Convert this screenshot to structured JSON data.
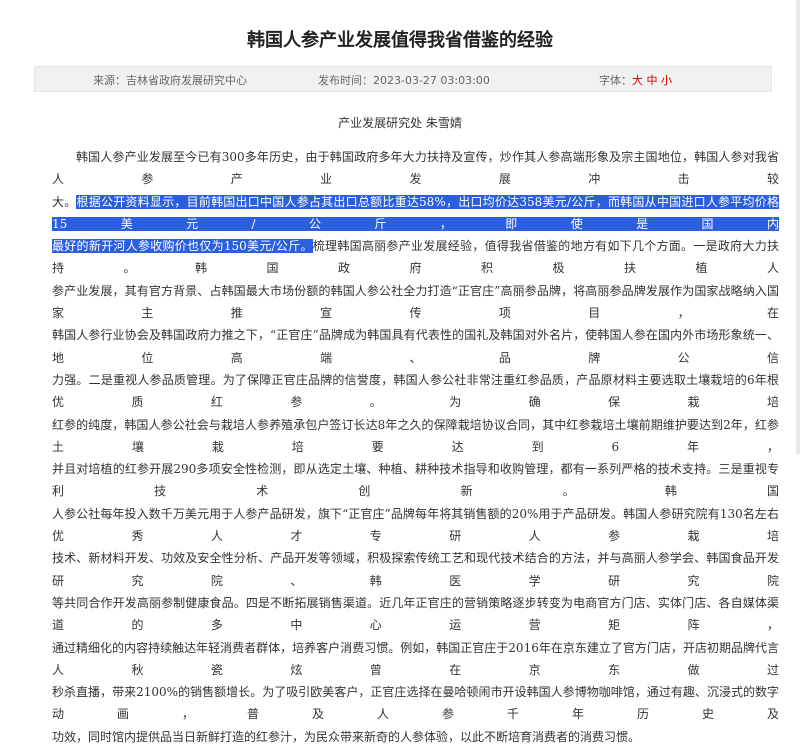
{
  "article": {
    "title": "韩国人参产业发展值得我省借鉴的经验",
    "meta": {
      "source_label": "来源：吉林省政府发展研究中心",
      "time_label": "发布时间：2023-03-27 03:03:00",
      "font_label": "字体：",
      "font_sizes": [
        "大",
        "中",
        "小"
      ]
    },
    "author": "产业发展研究处  朱雪婧",
    "lines": {
      "l1": "韩国人参产业发展至今已有300多年历史，由于韩国政府多年大力扶持及宣传，炒作其人参高端形象及宗主国地位，韩国人参对我省人参产业发展冲击较",
      "l2_plain": "大。",
      "l2_hl": "根据公开资料显示，目前韩国出口中国人参占其出口总额比重达58%，出口均价达358美元/公斤，而韩国从中国进口人参平均价格15美元/公斤，即使是国内",
      "l3_hl": "最好的新开河人参收购价也仅为150美元/公斤。",
      "l3_plain": "梳理韩国高丽参产业发展经验，值得我省借鉴的地方有如下几个方面。一是政府大力扶持。韩国政府积极扶植人",
      "l4": "参产业发展，其有官方背景、占韩国最大市场份额的韩国人参公社全力打造“正官庄”高丽参品牌，将高丽参品牌发展作为国家战略纳入国家主推宣传项目，在",
      "l5": "韩国人参行业协会及韩国政府力推之下，“正官庄”品牌成为韩国具有代表性的国礼及韩国对外名片，使韩国人参在国内外市场形象统一、地位高端、品牌公信",
      "l6": "力强。二是重视人参品质管理。为了保障正官庄品牌的信誉度，韩国人参公社非常注重红参品质，产品原材料主要选取土壤栽培的6年根优质红参。为确保栽培",
      "l7": "红参的纯度，韩国人参公社会与栽培人参养殖承包户签订长达8年之久的保障栽培协议合同，其中红参栽培土壤前期维护要达到2年，红参土壤栽培要达到6年，",
      "l8": "并且对培植的红参开展290多项安全性检测，即从选定土壤、种植、耕种技术指导和收购管理，都有一系列严格的技术支持。三是重视专利技术创新。韩国",
      "l9": "人参公社每年投入数千万美元用于人参产品研发，旗下“正官庄”品牌每年将其销售额的20%用于产品研发。韩国人参研究院有130名左右优秀人才专研人参栽培",
      "l10": "技术、新材料开发、功效及安全性分析、产品开发等领域，积极探索传统工艺和现代技术结合的方法，并与高丽人参学会、韩国食品开发研究院、韩医学研究院",
      "l11": "等共同合作开发高丽参制健康食品。四是不断拓展销售渠道。近几年正官庄的营销策略逐步转变为电商官方门店、实体门店、各自媒体渠道的多中心运营矩阵，",
      "l12": "通过精细化的内容持续触达年轻消费者群体，培养客户消费习惯。例如，韩国正官庄于2016年在京东建立了官方门店，开店初期品牌代言人秋瓷炫曾在京东做过",
      "l13": "秒杀直播，带来2100%的销售额增长。为了吸引欧美客户，正官庄选择在曼哈顿闹市开设韩国人参博物咖啡馆，通过有趣、沉浸式的数字动画，普及人参千年历史及",
      "l14": "功效，同时馆内提供品当日新鲜打造的红参汁，为民众带来新奇的人参体验，以此不断培育消费者的消费习惯。"
    }
  }
}
